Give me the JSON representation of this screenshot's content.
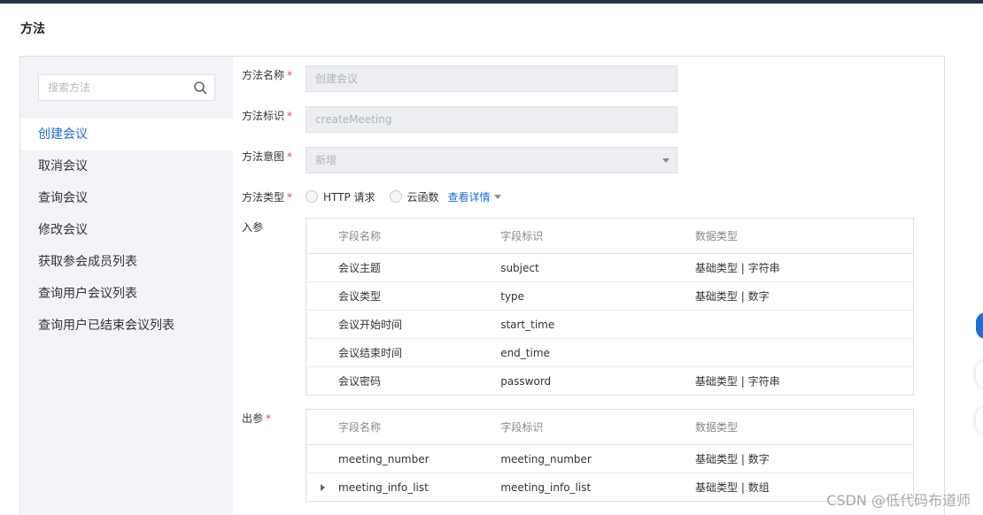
{
  "page": {
    "title": "方法"
  },
  "sidebar": {
    "search_placeholder": "搜索方法",
    "items": [
      {
        "label": "创建会议",
        "active": true
      },
      {
        "label": "取消会议"
      },
      {
        "label": "查询会议"
      },
      {
        "label": "修改会议"
      },
      {
        "label": "获取参会成员列表"
      },
      {
        "label": "查询用户会议列表"
      },
      {
        "label": "查询用户已结束会议列表"
      }
    ]
  },
  "form": {
    "method_name": {
      "label": "方法名称",
      "value": "创建会议"
    },
    "method_id": {
      "label": "方法标识",
      "value": "createMeeting"
    },
    "method_intent": {
      "label": "方法意图",
      "value": "新增"
    },
    "method_type": {
      "label": "方法类型",
      "options": [
        "HTTP 请求",
        "云函数"
      ],
      "detail_link": "查看详情"
    },
    "required_mark": "*",
    "input_params": {
      "label": "入参",
      "headers": [
        "字段名称",
        "字段标识",
        "数据类型"
      ],
      "rows": [
        [
          "会议主题",
          "subject",
          "基础类型 | 字符串"
        ],
        [
          "会议类型",
          "type",
          "基础类型 | 数字"
        ],
        [
          "会议开始时间",
          "start_time",
          ""
        ],
        [
          "会议结束时间",
          "end_time",
          ""
        ],
        [
          "会议密码",
          "password",
          "基础类型 | 字符串"
        ]
      ]
    },
    "output_params": {
      "label": "出参",
      "headers": [
        "字段名称",
        "字段标识",
        "数据类型"
      ],
      "rows": [
        [
          "meeting_number",
          "meeting_number",
          "基础类型 | 数字"
        ],
        [
          "meeting_info_list",
          "meeting_info_list",
          "基础类型 | 数组"
        ]
      ]
    }
  },
  "watermark": "CSDN @低代码布道师",
  "colors": {
    "accent": "#1a6fd6",
    "required": "#e5484d",
    "sidebar_bg": "#f3f4f7"
  },
  "icons": {
    "search": "search-icon",
    "select_arrow": "chevron-down-icon",
    "row_expander": "chevron-right-icon"
  }
}
